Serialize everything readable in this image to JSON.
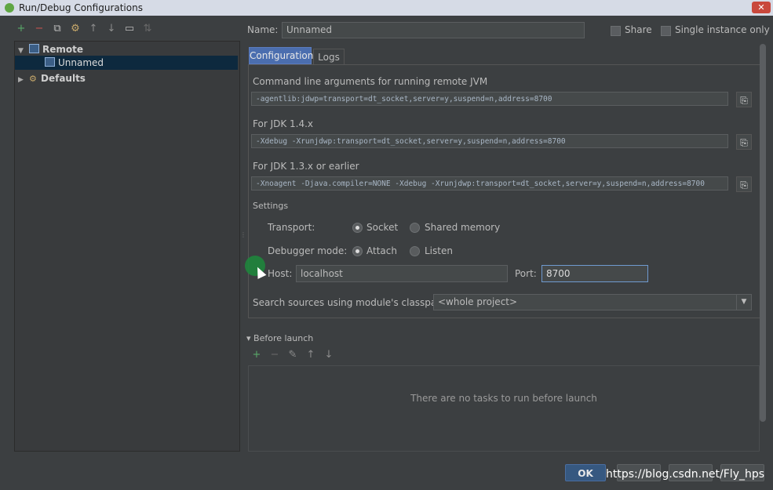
{
  "window": {
    "title": "Run/Debug Configurations",
    "close_glyph": "✕"
  },
  "left_toolbar": [
    {
      "name": "add-icon",
      "glyph": "+",
      "color": "#59a869"
    },
    {
      "name": "remove-icon",
      "glyph": "−",
      "color": "#c75450"
    },
    {
      "name": "copy-icon",
      "glyph": "⧉",
      "color": "#bbbbbb"
    },
    {
      "name": "edit-defaults-icon",
      "glyph": "⚙",
      "color": "#c8a96b"
    },
    {
      "name": "move-up-icon",
      "glyph": "↑",
      "color": "#8c8c8c"
    },
    {
      "name": "move-down-icon",
      "glyph": "↓",
      "color": "#8c8c8c"
    },
    {
      "name": "folder-icon",
      "glyph": "▭",
      "color": "#bbbbbb"
    },
    {
      "name": "sort-icon",
      "glyph": "⇅",
      "color": "#6a6a6a"
    }
  ],
  "tree": {
    "remote_label": "Remote",
    "unnamed_label": "Unnamed",
    "defaults_label": "Defaults"
  },
  "header": {
    "name_label": "Name:",
    "name_value": "Unnamed",
    "share_label": "Share",
    "single_instance_label": "Single instance only"
  },
  "tabs": {
    "configuration": "Configuration",
    "logs": "Logs"
  },
  "config": {
    "cmd_label": "Command line arguments for running remote JVM",
    "cmd_value": "-agentlib:jdwp=transport=dt_socket,server=y,suspend=n,address=8700",
    "jdk14_label": "For JDK 1.4.x",
    "jdk14_value": "-Xdebug -Xrunjdwp:transport=dt_socket,server=y,suspend=n,address=8700",
    "jdk13_label": "For JDK 1.3.x or earlier",
    "jdk13_value": "-Xnoagent -Djava.compiler=NONE -Xdebug -Xrunjdwp:transport=dt_socket,server=y,suspend=n,address=8700",
    "copy_glyph": "⎘",
    "settings_label": "Settings",
    "transport_label": "Transport:",
    "socket_label": "Socket",
    "shared_memory_label": "Shared memory",
    "debugger_mode_label": "Debugger mode:",
    "attach_label": "Attach",
    "listen_label": "Listen",
    "host_label": "Host:",
    "host_value": "localhost",
    "port_label": "Port:",
    "port_value": "8700",
    "classpath_label": "Search sources using module's classpath:",
    "classpath_value": "<whole project>",
    "dropdown_glyph": "▼"
  },
  "before_launch": {
    "label": "Before launch",
    "toggle_glyph": "▾",
    "empty_text": "There are no tasks to run before launch",
    "toolbar": [
      {
        "name": "add-task-icon",
        "glyph": "+",
        "color": "#59a869"
      },
      {
        "name": "remove-task-icon",
        "glyph": "−",
        "color": "#6a6a6a"
      },
      {
        "name": "edit-task-icon",
        "glyph": "✎",
        "color": "#8c8c8c"
      },
      {
        "name": "task-up-icon",
        "glyph": "↑",
        "color": "#8c8c8c"
      },
      {
        "name": "task-down-icon",
        "glyph": "↓",
        "color": "#8c8c8c"
      }
    ]
  },
  "footer": {
    "ok_label": "OK",
    "watermark": "https://blog.csdn.net/Fly_hps"
  }
}
